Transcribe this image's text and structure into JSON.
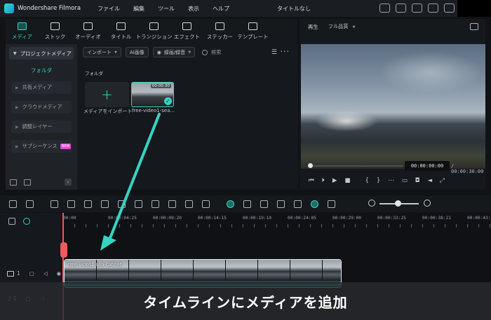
{
  "app": {
    "name": "Wondershare Filmora",
    "doc_title": "タイトルなし"
  },
  "menu": [
    "ファイル",
    "編集",
    "ツール",
    "表示",
    "ヘルプ"
  ],
  "ribbon_tabs": [
    {
      "label": "メディア",
      "icon": "media-icon",
      "active": true
    },
    {
      "label": "ストック",
      "icon": "stock-icon",
      "active": false
    },
    {
      "label": "オーディオ",
      "icon": "music-note-icon",
      "active": false
    },
    {
      "label": "タイトル",
      "icon": "title-t-icon",
      "active": false
    },
    {
      "label": "トランジション",
      "icon": "transition-icon",
      "active": false
    },
    {
      "label": "エフェクト",
      "icon": "sparkle-icon",
      "active": false
    },
    {
      "label": "ステッカー",
      "icon": "sticker-icon",
      "active": false
    },
    {
      "label": "テンプレート",
      "icon": "template-icon",
      "active": false
    }
  ],
  "sidebar": {
    "project_media": "プロジェクトメディア",
    "folder": "フォルダ",
    "items": [
      "共有メディア",
      "クラウドメディア",
      "調整レイヤー",
      "サブシーケンス"
    ],
    "new_badge": "NEW"
  },
  "media_toolbar": {
    "import": "インポート",
    "ai_image": "AI画像",
    "record": "録画/録音",
    "search_placeholder": "検索"
  },
  "media": {
    "folder_title": "フォルダ",
    "import_label": "メディアをインポート",
    "clip_label": "free-video1-sea...",
    "clip_duration": "00:00:30"
  },
  "player": {
    "label": "再生",
    "quality": "フル品質",
    "current_time": "00:00:00:00",
    "total_time": "/ 00:00:30:00",
    "progress": 0
  },
  "timeline": {
    "ruler": [
      "00:00",
      "00:00:04:25",
      "00:00:09:20",
      "00:00:14:15",
      "00:00:19:10",
      "00:00:24:05",
      "00:00:29:00",
      "00:00:33:25",
      "00:00:38:21",
      "00:00:43:16"
    ],
    "video_track_num": "1",
    "audio_track_num": "1",
    "clip_name": "free-video1-sea-cafinet",
    "zoom_level": 0.4
  },
  "caption": "タイムラインにメディアを追加",
  "colors": {
    "accent": "#39d3c5",
    "playhead": "#f05a5a",
    "background": "#101215"
  }
}
